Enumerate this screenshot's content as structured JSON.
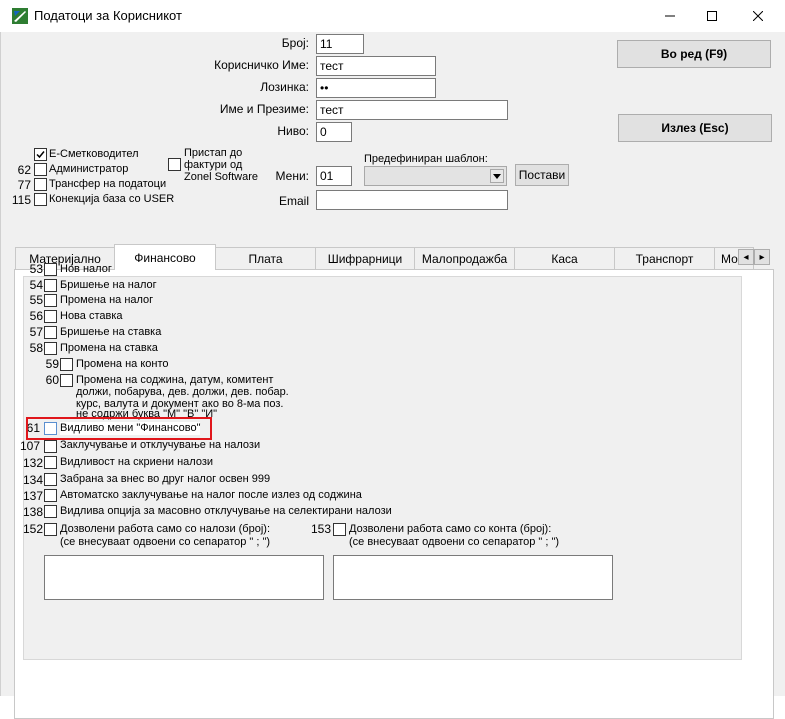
{
  "window": {
    "title": "Податоци за Корисникот",
    "icon": "app-logo-icon"
  },
  "form": {
    "broj_label": "Број:",
    "broj_value": "11",
    "korisnicko_label": "Корисничко Име:",
    "korisnicko_value": "тест",
    "lozinka_label": "Лозинка:",
    "lozinka_value": "••",
    "ime_label": "Име и Презиме:",
    "ime_value": "тест",
    "nivo_label": "Ниво:",
    "nivo_value": "0",
    "meni_label": "Мени:",
    "meni_value": "01",
    "email_label": "Email",
    "email_value": "",
    "sablon_label": "Предефиниран шаблон:",
    "sablon_value": "",
    "postavi_button": "Постави"
  },
  "buttons": {
    "ok": "Во ред (F9)",
    "exit": "Излез (Esc)"
  },
  "top_checks": [
    {
      "num": "",
      "label": "Е-Сметководител",
      "checked": true
    },
    {
      "num": "62",
      "label": "Администратор",
      "checked": false
    },
    {
      "num": "77",
      "label": "Трансфер на податоци",
      "checked": false
    },
    {
      "num": "115",
      "label": "Конекција база со USER",
      "checked": false
    }
  ],
  "pristap": {
    "line1": "Пристап до",
    "line2": "фактури од",
    "line3": "Zonel Software",
    "checked": false
  },
  "tabs": [
    "Материјално",
    "Финансово",
    "Плата",
    "Шифрарници",
    "Малопродажба",
    "Каса",
    "Транспорт",
    "Мо"
  ],
  "active_tab": "Финансово",
  "tab_scroll": {
    "left": "◂",
    "right": "▸"
  },
  "permissions": [
    {
      "num": "53",
      "label": "Нов налог"
    },
    {
      "num": "54",
      "label": "Бришење на налог"
    },
    {
      "num": "55",
      "label": "Промена на налог"
    },
    {
      "num": "56",
      "label": "Нова ставка"
    },
    {
      "num": "57",
      "label": "Бришење на ставка"
    },
    {
      "num": "58",
      "label": "Промена на ставка"
    },
    {
      "num": "59",
      "label": "Промена на конто"
    },
    {
      "num": "60",
      "label": "Промена на соджина, датум, комитент"
    },
    {
      "num": "61",
      "label": "Видливо мени \"Финансово\""
    },
    {
      "num": "107",
      "label": "Заклучување и отклучување на налози"
    },
    {
      "num": "132",
      "label": "Видливост на скриени налози"
    },
    {
      "num": "134",
      "label": "Забрана за внес во друг налог освен 999"
    },
    {
      "num": "137",
      "label": "Автоматско заклучување на налог после излез од соджина"
    },
    {
      "num": "138",
      "label": "Видлива опција за масовно отклучување на селектирани налози"
    },
    {
      "num": "152",
      "label": "Дозволени работа само со налози (број):"
    },
    {
      "num": "153",
      "label": "Дозволени работа само со конта (број):"
    }
  ],
  "perm60_extra": [
    "должи, побарува, дев. должи, дев. побар.",
    "курс, валута и документ ако во 8-ма поз.",
    "не содржи буква \"М\" \"В\" \"И\""
  ],
  "separator_note": "(се внесуваат одвоени со сепаратор \" ; \")"
}
